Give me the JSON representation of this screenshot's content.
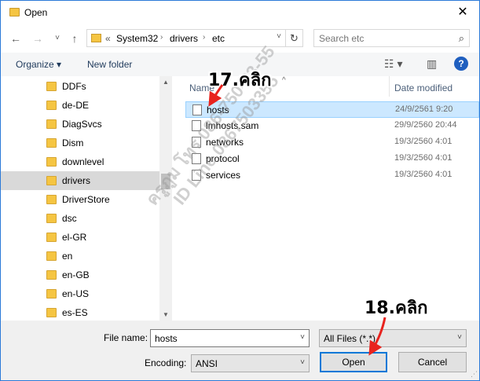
{
  "window": {
    "title": "Open",
    "close_glyph": "✕"
  },
  "address": {
    "back": "←",
    "forward": "→",
    "recent": "˅",
    "up": "↑",
    "overflow": "«",
    "crumbs": [
      "System32",
      "drivers",
      "etc"
    ],
    "sep": "›",
    "dropdown": "˅",
    "refresh": "↻"
  },
  "search": {
    "placeholder": "Search etc",
    "icon": "⌕"
  },
  "toolbar": {
    "organize": "Organize ▾",
    "new_folder": "New folder",
    "view_glyph": "☷ ▾",
    "pane_glyph": "▥",
    "help": "?"
  },
  "nav": {
    "items": [
      {
        "label": "DDFs"
      },
      {
        "label": "de-DE"
      },
      {
        "label": "DiagSvcs"
      },
      {
        "label": "Dism"
      },
      {
        "label": "downlevel"
      },
      {
        "label": "drivers",
        "selected": true
      },
      {
        "label": "DriverStore"
      },
      {
        "label": "dsc"
      },
      {
        "label": "el-GR"
      },
      {
        "label": "en"
      },
      {
        "label": "en-GB"
      },
      {
        "label": "en-US"
      },
      {
        "label": "es-ES"
      }
    ],
    "scroll_up": "▲",
    "scroll_down": "▼"
  },
  "files": {
    "col_name": "Name",
    "col_date": "Date modified",
    "sort_glyph": "^",
    "rows": [
      {
        "name": "hosts",
        "date": "24/9/2561 9:20",
        "selected": true
      },
      {
        "name": "lmhosts.sam",
        "date": "29/9/2560 20:44"
      },
      {
        "name": "networks",
        "date": "19/3/2560 4:01"
      },
      {
        "name": "protocol",
        "date": "19/3/2560 4:01"
      },
      {
        "name": "services",
        "date": "19/3/2560 4:01"
      }
    ]
  },
  "bottom": {
    "file_name_label": "File name:",
    "file_name_value": "hosts",
    "filter_value": "All Files  (*.*)",
    "encoding_label": "Encoding:",
    "encoding_value": "ANSI",
    "open": "Open",
    "cancel": "Cancel",
    "dropdown": "˅",
    "grip": "⋰"
  },
  "annotations": {
    "step17": "17.คลิก",
    "step18": "18.คลิก",
    "watermark_1": "ครูภูม โทร 086-750-33-55",
    "watermark_2": "ID Line 0867503355",
    "arrow_color": "#e8231e"
  }
}
